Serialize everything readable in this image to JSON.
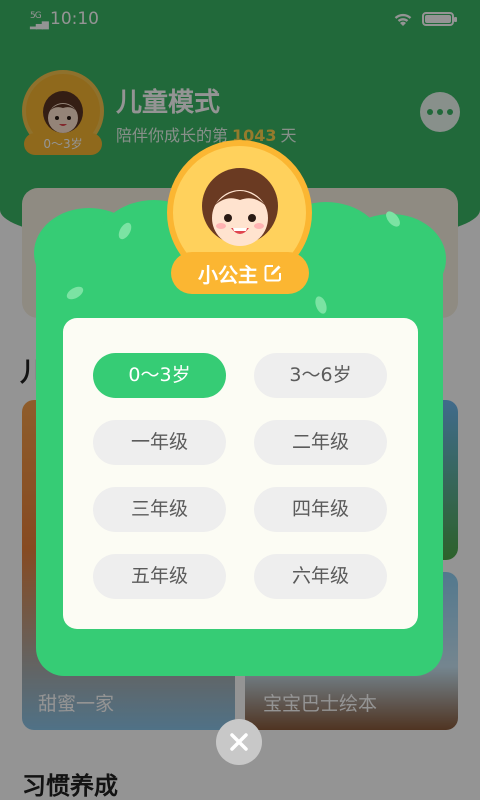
{
  "status_bar": {
    "signal": "5G\nall",
    "time": "10:10"
  },
  "header": {
    "title": "儿童模式",
    "companion_prefix": "陪伴你成长的第",
    "companion_days": "1043",
    "companion_suffix": "天",
    "age_chip": "0～3岁"
  },
  "background": {
    "section_title_partial": "儿",
    "cards": [
      {
        "caption": "甜蜜一家"
      },
      {
        "caption": "宝宝巴士绘本"
      }
    ],
    "section_habits": "习惯养成"
  },
  "modal": {
    "profile_name": "小公主",
    "grades": [
      "0～3岁",
      "3～6岁",
      "一年级",
      "二年级",
      "三年级",
      "四年级",
      "五年级",
      "六年级"
    ],
    "selected_grade": "0～3岁"
  },
  "colors": {
    "brand_green": "#36cc75",
    "header_green": "#39b565",
    "avatar_gold": "#fbb632",
    "panel_bg": "#fcfcf4",
    "chip_grey": "#eeeeee"
  },
  "icons": {
    "more": "more-icon",
    "edit": "edit-icon",
    "close": "close-icon",
    "wifi": "wifi-icon",
    "battery": "battery-icon"
  }
}
